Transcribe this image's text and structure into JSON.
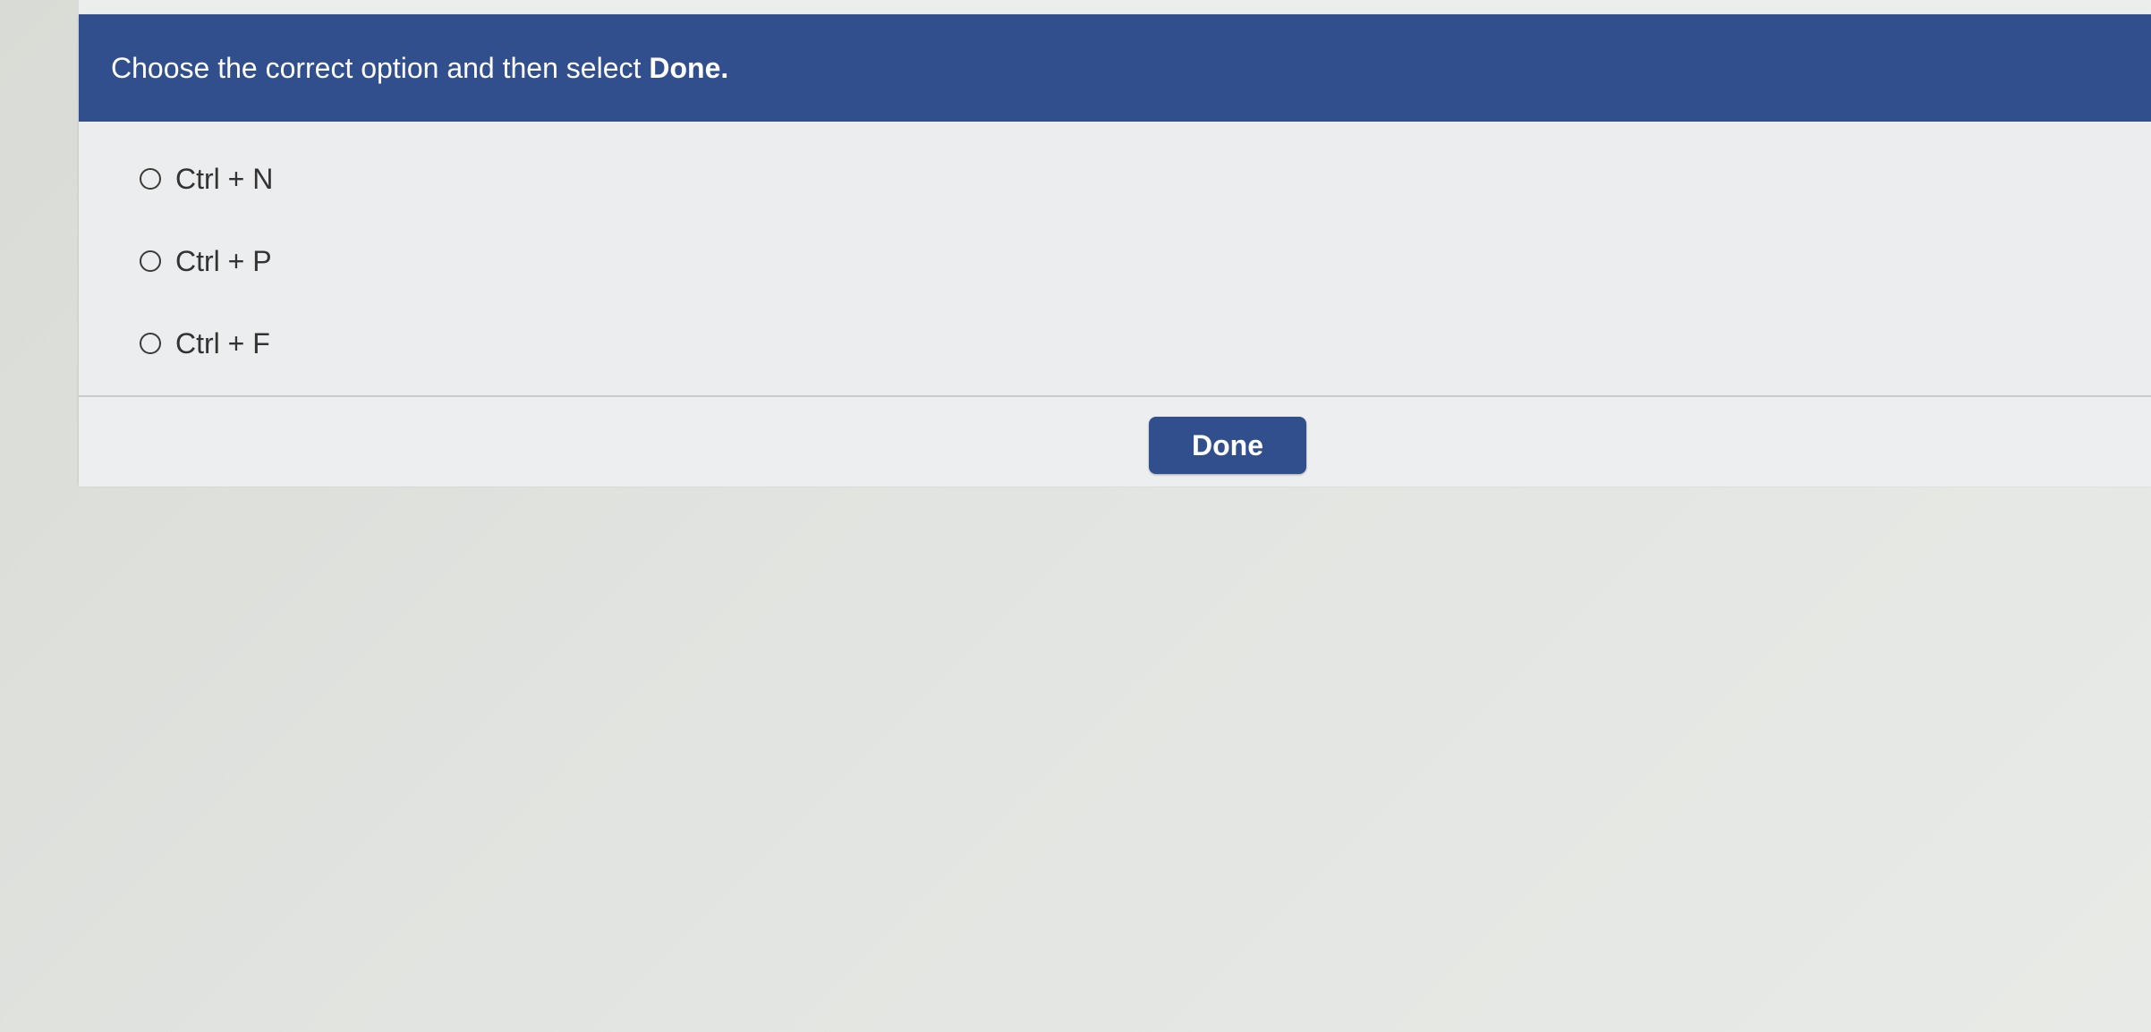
{
  "question": {
    "instruction_text": "Choose the correct option and then select",
    "instruction_bold": "Done."
  },
  "options": [
    {
      "label": "Ctrl + N",
      "selected": false
    },
    {
      "label": "Ctrl + P",
      "selected": false
    },
    {
      "label": "Ctrl + F",
      "selected": false
    }
  ],
  "footer": {
    "done_label": "Done"
  },
  "colors": {
    "header_bg": "#324f8d",
    "button_bg": "#324f8d",
    "panel_bg": "#ecedee"
  }
}
